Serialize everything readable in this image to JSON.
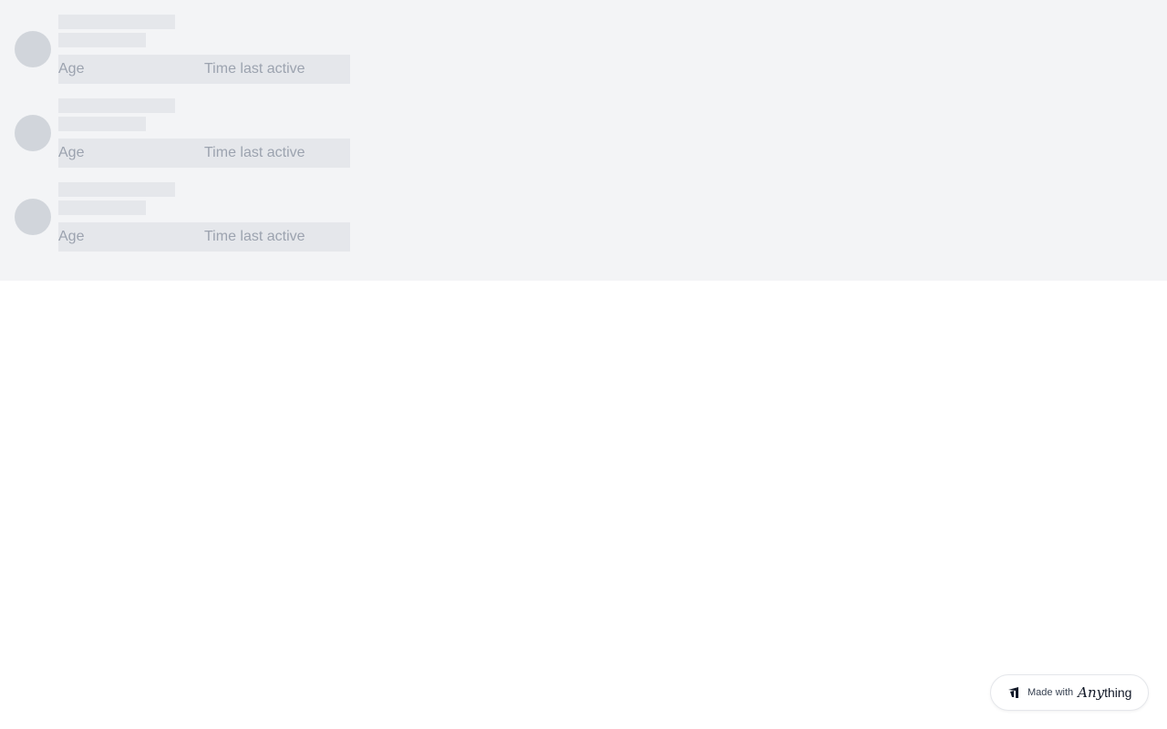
{
  "rows": [
    {
      "age_label": "Age",
      "time_label": "Time last active"
    },
    {
      "age_label": "Age",
      "time_label": "Time last active"
    },
    {
      "age_label": "Age",
      "time_label": "Time last active"
    }
  ],
  "badge": {
    "prefix": "Made with",
    "brand_stylized": "Any",
    "brand_rest": "thing",
    "icon": "anything-logo-icon"
  },
  "colors": {
    "panel_bg": "#f3f4f6",
    "skeleton_fill": "#e5e7eb",
    "avatar_fill": "#d1d5db",
    "muted_text": "#9ca3af"
  }
}
